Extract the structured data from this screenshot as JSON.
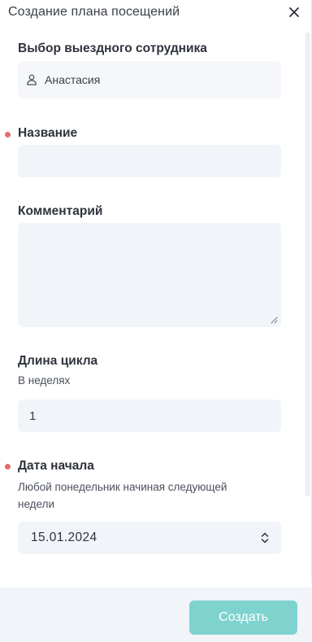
{
  "header": {
    "title": "Создание плана посещений",
    "close_icon": "close-icon"
  },
  "employee": {
    "label": "Выбор выездного сотрудника",
    "value": "Анастасия",
    "icon": "user-icon"
  },
  "name_field": {
    "label": "Название",
    "value": "",
    "required": true
  },
  "comment_field": {
    "label": "Комментарий",
    "value": ""
  },
  "cycle_length": {
    "label": "Длина цикла",
    "hint": "В неделях",
    "value": "1"
  },
  "start_date": {
    "label": "Дата начала",
    "hint": "Любой понедельник начиная следующей недели",
    "value": "15.01.2024",
    "required": true
  },
  "footer": {
    "create_label": "Создать"
  },
  "colors": {
    "required_dot": "#e46b6b",
    "create_button": "#7fd3cf",
    "field_bg": "#f1f4f8"
  }
}
